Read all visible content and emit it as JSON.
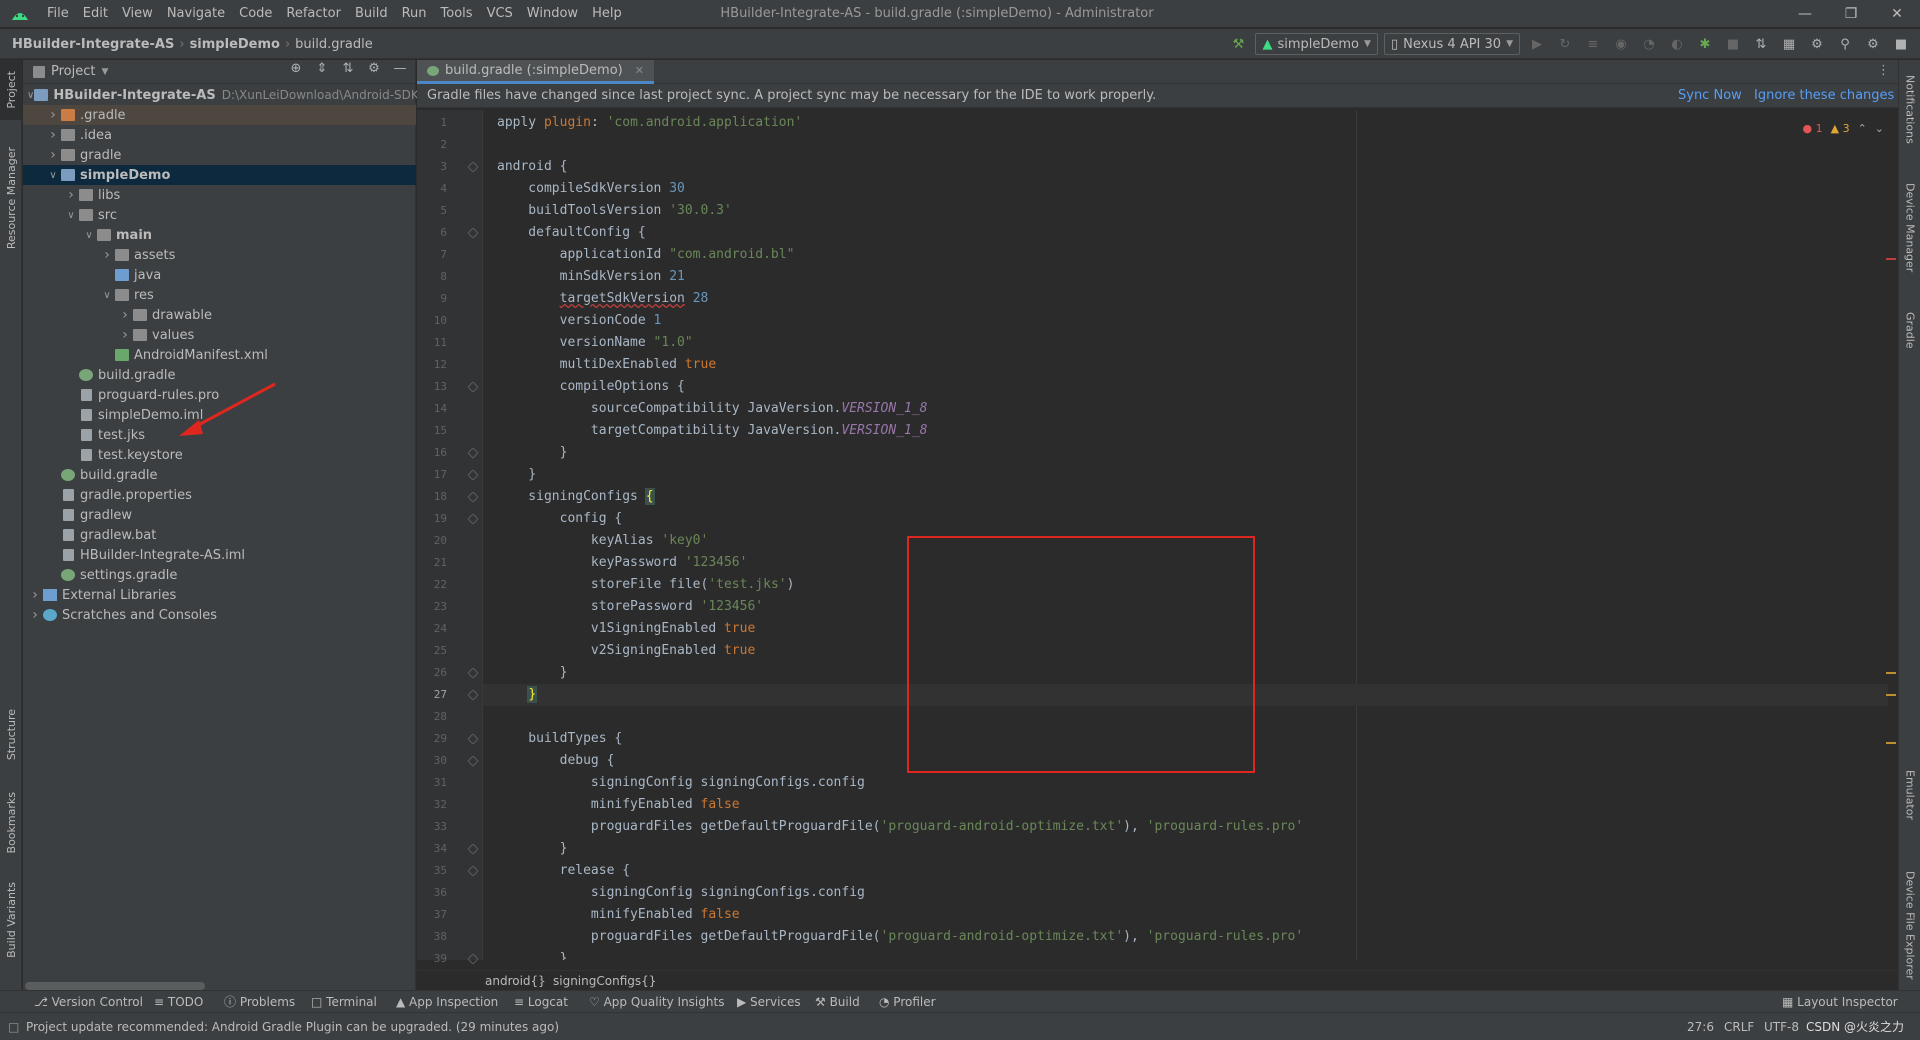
{
  "menu": [
    "File",
    "Edit",
    "View",
    "Navigate",
    "Code",
    "Refactor",
    "Build",
    "Run",
    "Tools",
    "VCS",
    "Window",
    "Help"
  ],
  "window_title": "HBuilder-Integrate-AS - build.gradle (:simpleDemo) - Administrator",
  "breadcrumb": [
    "HBuilder-Integrate-AS",
    "simpleDemo",
    "build.gradle"
  ],
  "run_config": "simpleDemo",
  "device": "Nexus 4 API 30",
  "left_tabs": [
    "Project",
    "Resource Manager",
    "Structure",
    "Bookmarks",
    "Build Variants"
  ],
  "right_tabs": [
    "Notifications",
    "Device Manager",
    "Gradle",
    "Emulator",
    "Device File Explorer"
  ],
  "project_panel": {
    "title": "Project",
    "root_hint": "D:\\XunLeiDownload\\Android-SDK@",
    "items": [
      {
        "label": "HBuilder-Integrate-AS",
        "type": "module",
        "depth": 0,
        "arrow": "down"
      },
      {
        "label": ".gradle",
        "type": "folder-orange",
        "depth": 1,
        "arrow": "right"
      },
      {
        "label": ".idea",
        "type": "folder",
        "depth": 1,
        "arrow": "right"
      },
      {
        "label": "gradle",
        "type": "folder",
        "depth": 1,
        "arrow": "right"
      },
      {
        "label": "simpleDemo",
        "type": "module",
        "depth": 1,
        "arrow": "down"
      },
      {
        "label": "libs",
        "type": "folder",
        "depth": 2,
        "arrow": "right"
      },
      {
        "label": "src",
        "type": "folder",
        "depth": 2,
        "arrow": "down"
      },
      {
        "label": "main",
        "type": "folder",
        "depth": 3,
        "arrow": "down"
      },
      {
        "label": "assets",
        "type": "folder",
        "depth": 4,
        "arrow": "right"
      },
      {
        "label": "java",
        "type": "folder-blue",
        "depth": 4,
        "arrow": ""
      },
      {
        "label": "res",
        "type": "folder",
        "depth": 4,
        "arrow": "down"
      },
      {
        "label": "drawable",
        "type": "folder",
        "depth": 5,
        "arrow": "right"
      },
      {
        "label": "values",
        "type": "folder",
        "depth": 5,
        "arrow": "right"
      },
      {
        "label": "AndroidManifest.xml",
        "type": "xml",
        "depth": 4,
        "arrow": ""
      },
      {
        "label": "build.gradle",
        "type": "gradle",
        "depth": 2,
        "arrow": ""
      },
      {
        "label": "proguard-rules.pro",
        "type": "file",
        "depth": 2,
        "arrow": ""
      },
      {
        "label": "simpleDemo.iml",
        "type": "file",
        "depth": 2,
        "arrow": ""
      },
      {
        "label": "test.jks",
        "type": "file",
        "depth": 2,
        "arrow": ""
      },
      {
        "label": "test.keystore",
        "type": "file",
        "depth": 2,
        "arrow": ""
      },
      {
        "label": "build.gradle",
        "type": "gradle",
        "depth": 1,
        "arrow": ""
      },
      {
        "label": "gradle.properties",
        "type": "file",
        "depth": 1,
        "arrow": ""
      },
      {
        "label": "gradlew",
        "type": "file",
        "depth": 1,
        "arrow": ""
      },
      {
        "label": "gradlew.bat",
        "type": "file",
        "depth": 1,
        "arrow": ""
      },
      {
        "label": "HBuilder-Integrate-AS.iml",
        "type": "file",
        "depth": 1,
        "arrow": ""
      },
      {
        "label": "settings.gradle",
        "type": "gradle",
        "depth": 1,
        "arrow": ""
      },
      {
        "label": "External Libraries",
        "type": "lib",
        "depth": 0,
        "arrow": "right"
      },
      {
        "label": "Scratches and Consoles",
        "type": "scratch",
        "depth": 0,
        "arrow": "right"
      }
    ]
  },
  "editor": {
    "tab_label": "build.gradle (:simpleDemo)",
    "notice": "Gradle files have changed since last project sync. A project sync may be necessary for the IDE to work properly.",
    "sync_now": "Sync Now",
    "ignore": "Ignore these changes",
    "errors": "1",
    "warnings": "3",
    "current_line": 27,
    "lines": [
      [
        [
          "apply ",
          "p"
        ],
        [
          "plugin",
          "kw"
        ],
        [
          ": ",
          "p"
        ],
        [
          "'com.android.application'",
          "st"
        ]
      ],
      [],
      [
        [
          "android {",
          "p"
        ]
      ],
      [
        [
          "    compileSdkVersion ",
          "p"
        ],
        [
          "30",
          "nu"
        ]
      ],
      [
        [
          "    buildToolsVersion ",
          "p"
        ],
        [
          "'30.0.3'",
          "st"
        ]
      ],
      [
        [
          "    defaultConfig {",
          "p"
        ]
      ],
      [
        [
          "        applicationId ",
          "p"
        ],
        [
          "\"com.android.bl\"",
          "st"
        ]
      ],
      [
        [
          "        minSdkVersion ",
          "p"
        ],
        [
          "21",
          "nu"
        ]
      ],
      [
        [
          "        ",
          "p"
        ],
        [
          "targetSdkVersion",
          "wv"
        ],
        [
          " ",
          "p"
        ],
        [
          "28",
          "nu"
        ]
      ],
      [
        [
          "        versionCode ",
          "p"
        ],
        [
          "1",
          "nu"
        ]
      ],
      [
        [
          "        versionName ",
          "p"
        ],
        [
          "\"1.0\"",
          "st"
        ]
      ],
      [
        [
          "        multiDexEnabled ",
          "p"
        ],
        [
          "true",
          "kw"
        ]
      ],
      [
        [
          "        compileOptions {",
          "p"
        ]
      ],
      [
        [
          "            sourceCompatibility JavaVersion.",
          "p"
        ],
        [
          "VERSION_1_8",
          "it"
        ]
      ],
      [
        [
          "            targetCompatibility JavaVersion.",
          "p"
        ],
        [
          "VERSION_1_8",
          "it"
        ]
      ],
      [
        [
          "        }",
          "p"
        ]
      ],
      [
        [
          "    }",
          "p"
        ]
      ],
      [
        [
          "    signingConfigs ",
          "p"
        ],
        [
          "{",
          "bm"
        ]
      ],
      [
        [
          "        config {",
          "p"
        ]
      ],
      [
        [
          "            keyAlias ",
          "p"
        ],
        [
          "'key0'",
          "st"
        ]
      ],
      [
        [
          "            keyPassword ",
          "p"
        ],
        [
          "'123456'",
          "st"
        ]
      ],
      [
        [
          "            storeFile file(",
          "p"
        ],
        [
          "'test.jks'",
          "st"
        ],
        [
          ")",
          "p"
        ]
      ],
      [
        [
          "            storePassword ",
          "p"
        ],
        [
          "'123456'",
          "st"
        ]
      ],
      [
        [
          "            v1SigningEnabled ",
          "p"
        ],
        [
          "true",
          "kw"
        ]
      ],
      [
        [
          "            v2SigningEnabled ",
          "p"
        ],
        [
          "true",
          "kw"
        ]
      ],
      [
        [
          "        }",
          "p"
        ]
      ],
      [
        [
          "    ",
          "p"
        ],
        [
          "}",
          "bm"
        ]
      ],
      [],
      [
        [
          "    buildTypes {",
          "p"
        ]
      ],
      [
        [
          "        debug {",
          "p"
        ]
      ],
      [
        [
          "            signingConfig signingConfigs.config",
          "p"
        ]
      ],
      [
        [
          "            minifyEnabled ",
          "p"
        ],
        [
          "false",
          "kw"
        ]
      ],
      [
        [
          "            proguardFiles getDefaultProguardFile(",
          "p"
        ],
        [
          "'proguard-android-optimize.txt'",
          "st"
        ],
        [
          "), ",
          "p"
        ],
        [
          "'proguard-rules.pro'",
          "st"
        ]
      ],
      [
        [
          "        }",
          "p"
        ]
      ],
      [
        [
          "        release {",
          "p"
        ]
      ],
      [
        [
          "            signingConfig signingConfigs.config",
          "p"
        ]
      ],
      [
        [
          "            minifyEnabled ",
          "p"
        ],
        [
          "false",
          "kw"
        ]
      ],
      [
        [
          "            proguardFiles getDefaultProguardFile(",
          "p"
        ],
        [
          "'proguard-android-optimize.txt'",
          "st"
        ],
        [
          "), ",
          "p"
        ],
        [
          "'proguard-rules.pro'",
          "st"
        ]
      ],
      [
        [
          "        }",
          "p"
        ]
      ]
    ],
    "breadcrumb": [
      "android{}",
      "signingConfigs{}"
    ]
  },
  "bottom_tools": [
    "Version Control",
    "TODO",
    "Problems",
    "Terminal",
    "App Inspection",
    "Logcat",
    "App Quality Insights",
    "Services",
    "Build",
    "Profiler"
  ],
  "layout_inspector": "Layout Inspector",
  "status": {
    "message": "Project update recommended: Android Gradle Plugin can be upgraded. (29 minutes ago)",
    "position": "27:6",
    "line_sep": "CRLF",
    "encoding": "UTF-8",
    "watermark": "CSDN @火炎之力"
  },
  "colors": {
    "accent": "#4a88c7",
    "selection": "#0d293e",
    "highlight_box": "#e0271f",
    "link": "#589df6"
  }
}
